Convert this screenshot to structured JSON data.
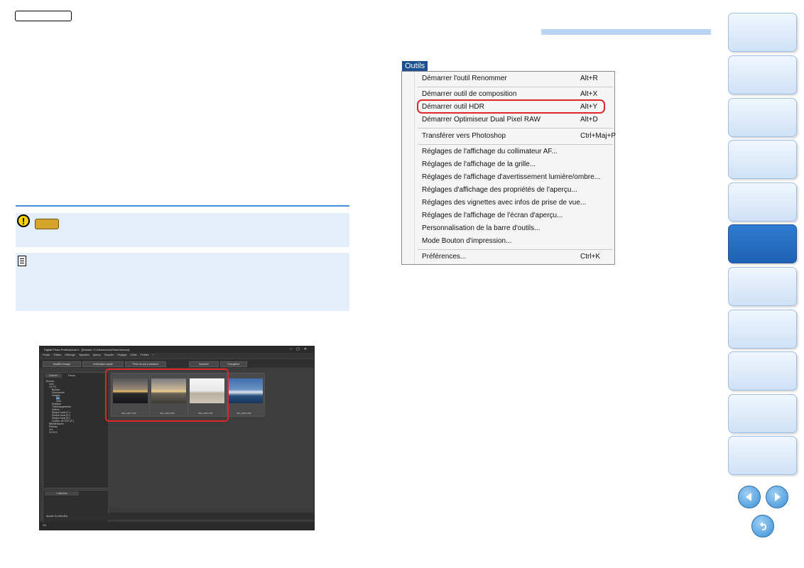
{
  "menu": {
    "title": "Outils",
    "items": [
      {
        "label": "Démarrer l'outil Renommer",
        "shortcut": "Alt+R"
      },
      {
        "label": "Démarrer outil de composition",
        "shortcut": "Alt+X"
      },
      {
        "label": "Démarrer outil HDR",
        "shortcut": "Alt+Y",
        "highlighted": true
      },
      {
        "label": "Démarrer Optimiseur Dual Pixel RAW",
        "shortcut": "Alt+D"
      },
      {
        "label": "Transférer vers Photoshop",
        "shortcut": "Ctrl+Maj+P"
      },
      {
        "label": "Réglages de l'affichage du collimateur AF...",
        "shortcut": ""
      },
      {
        "label": "Réglages de l'affichage de la grille...",
        "shortcut": ""
      },
      {
        "label": "Réglages de l'affichage d'avertissement lumière/ombre...",
        "shortcut": ""
      },
      {
        "label": "Réglages d'affichage des propriétés de l'aperçu...",
        "shortcut": ""
      },
      {
        "label": "Réglages des vignettes avec infos de prise de vue...",
        "shortcut": ""
      },
      {
        "label": "Réglages de l'affichage de l'écran d'aperçu...",
        "shortcut": ""
      },
      {
        "label": "Personnalisation de la barre d'outils...",
        "shortcut": ""
      },
      {
        "label": "Mode Bouton d'impression...",
        "shortcut": ""
      },
      {
        "label": "Préférences...",
        "shortcut": "Ctrl+K"
      }
    ]
  },
  "dpp": {
    "window_title": "Digital Photo Professional 4 - [Dossier: C:\\Users\\xxxx\\Pictures\\xxxx]",
    "menubar": [
      "Fichier",
      "Edition",
      "Affichage",
      "Vignettes",
      "Aperçu",
      "Requête",
      "Réglage",
      "Outils",
      "Fenêtre",
      "?"
    ],
    "toolbar": [
      "Modifier l'image",
      "Vérification rapide",
      "Prise de vue à distance",
      "Imprimer",
      "Enregistrer"
    ],
    "tabs": [
      "Dossier",
      "Favori"
    ],
    "tree": [
      "Bureau",
      "xxxx",
      "Ce PC",
      "Bureau",
      "Documents",
      "Images",
      "xxx",
      "xxxx",
      "Musique",
      "Téléchargements",
      "Vidéos",
      "Disque local (C:)",
      "Disque local (D:)",
      "Disque local (E:)",
      "Lecteur de DVD (F:)",
      "Bibliothèques",
      "Réseau",
      "xxx",
      "XXXXX"
    ],
    "collection_label": "Collection",
    "add_collection": "Ajouter la collection",
    "thumbnails": [
      "IMG_0001.CR2",
      "IMG_0002.CR2",
      "IMG_0003.CR2",
      "IMG_0004.CR2"
    ],
    "status": "4/4"
  }
}
